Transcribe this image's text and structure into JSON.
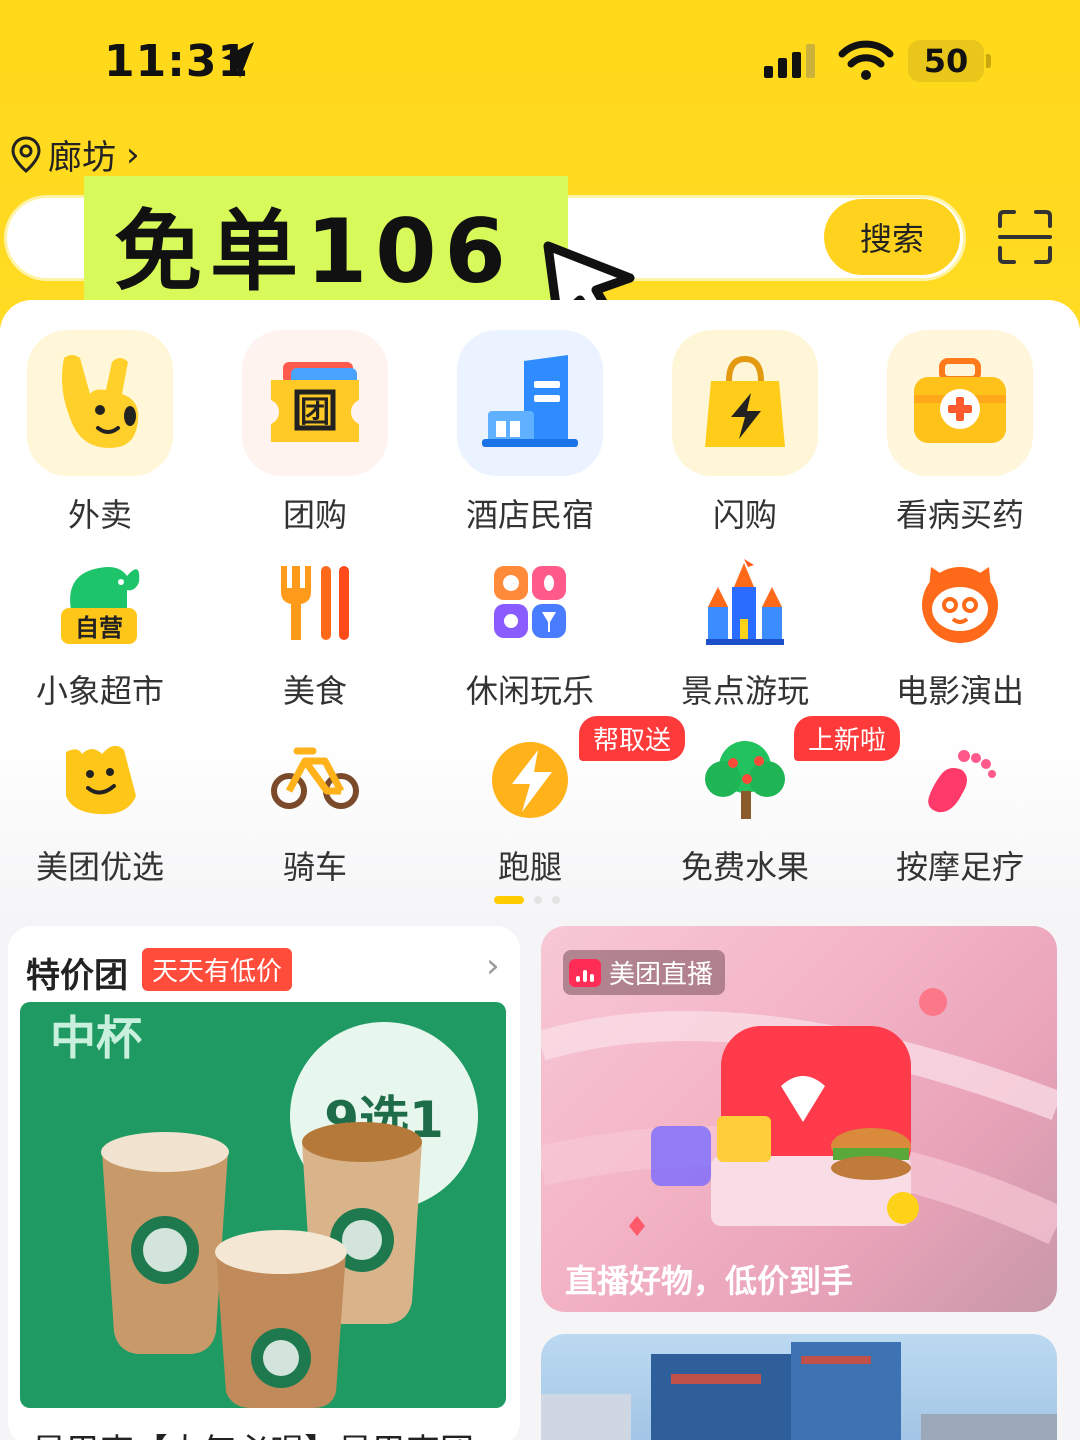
{
  "status_bar": {
    "time": "11:31",
    "battery": "50"
  },
  "location": {
    "label": "廊坊"
  },
  "search": {
    "promo_text": "免单106",
    "button_label": "搜索"
  },
  "grid": [
    {
      "label": "外卖",
      "icon": "waimai-rabbit-icon"
    },
    {
      "label": "团购",
      "icon": "tuangou-ticket-icon"
    },
    {
      "label": "酒店民宿",
      "icon": "hotel-building-icon"
    },
    {
      "label": "闪购",
      "icon": "flash-bag-icon"
    },
    {
      "label": "看病买药",
      "icon": "medicine-kit-icon"
    },
    {
      "label": "小象超市",
      "icon": "elephant-icon",
      "sub_tag": "自营"
    },
    {
      "label": "美食",
      "icon": "fork-knife-icon"
    },
    {
      "label": "休闲玩乐",
      "icon": "leisure-icon"
    },
    {
      "label": "景点游玩",
      "icon": "castle-icon"
    },
    {
      "label": "电影演出",
      "icon": "cat-icon"
    },
    {
      "label": "美团优选",
      "icon": "smiley-bag-icon"
    },
    {
      "label": "骑车",
      "icon": "bicycle-icon"
    },
    {
      "label": "跑腿",
      "icon": "runner-icon",
      "tag": "帮取送"
    },
    {
      "label": "免费水果",
      "icon": "fruit-tree-icon",
      "tag": "上新啦"
    },
    {
      "label": "按摩足疗",
      "icon": "footprint-icon"
    }
  ],
  "cards": {
    "left": {
      "title": "特价团",
      "badge": "天天有低价",
      "image_text_1": "中杯",
      "image_text_2": "9选1",
      "description": "星巴克【大气必喝】星巴克团"
    },
    "right": {
      "badge": "美团直播",
      "description": "直播好物，低价到手"
    }
  },
  "colors": {
    "brand_yellow": "#ffd919",
    "promo_green": "#d8f95a",
    "tag_red": "#ff3a3a"
  }
}
